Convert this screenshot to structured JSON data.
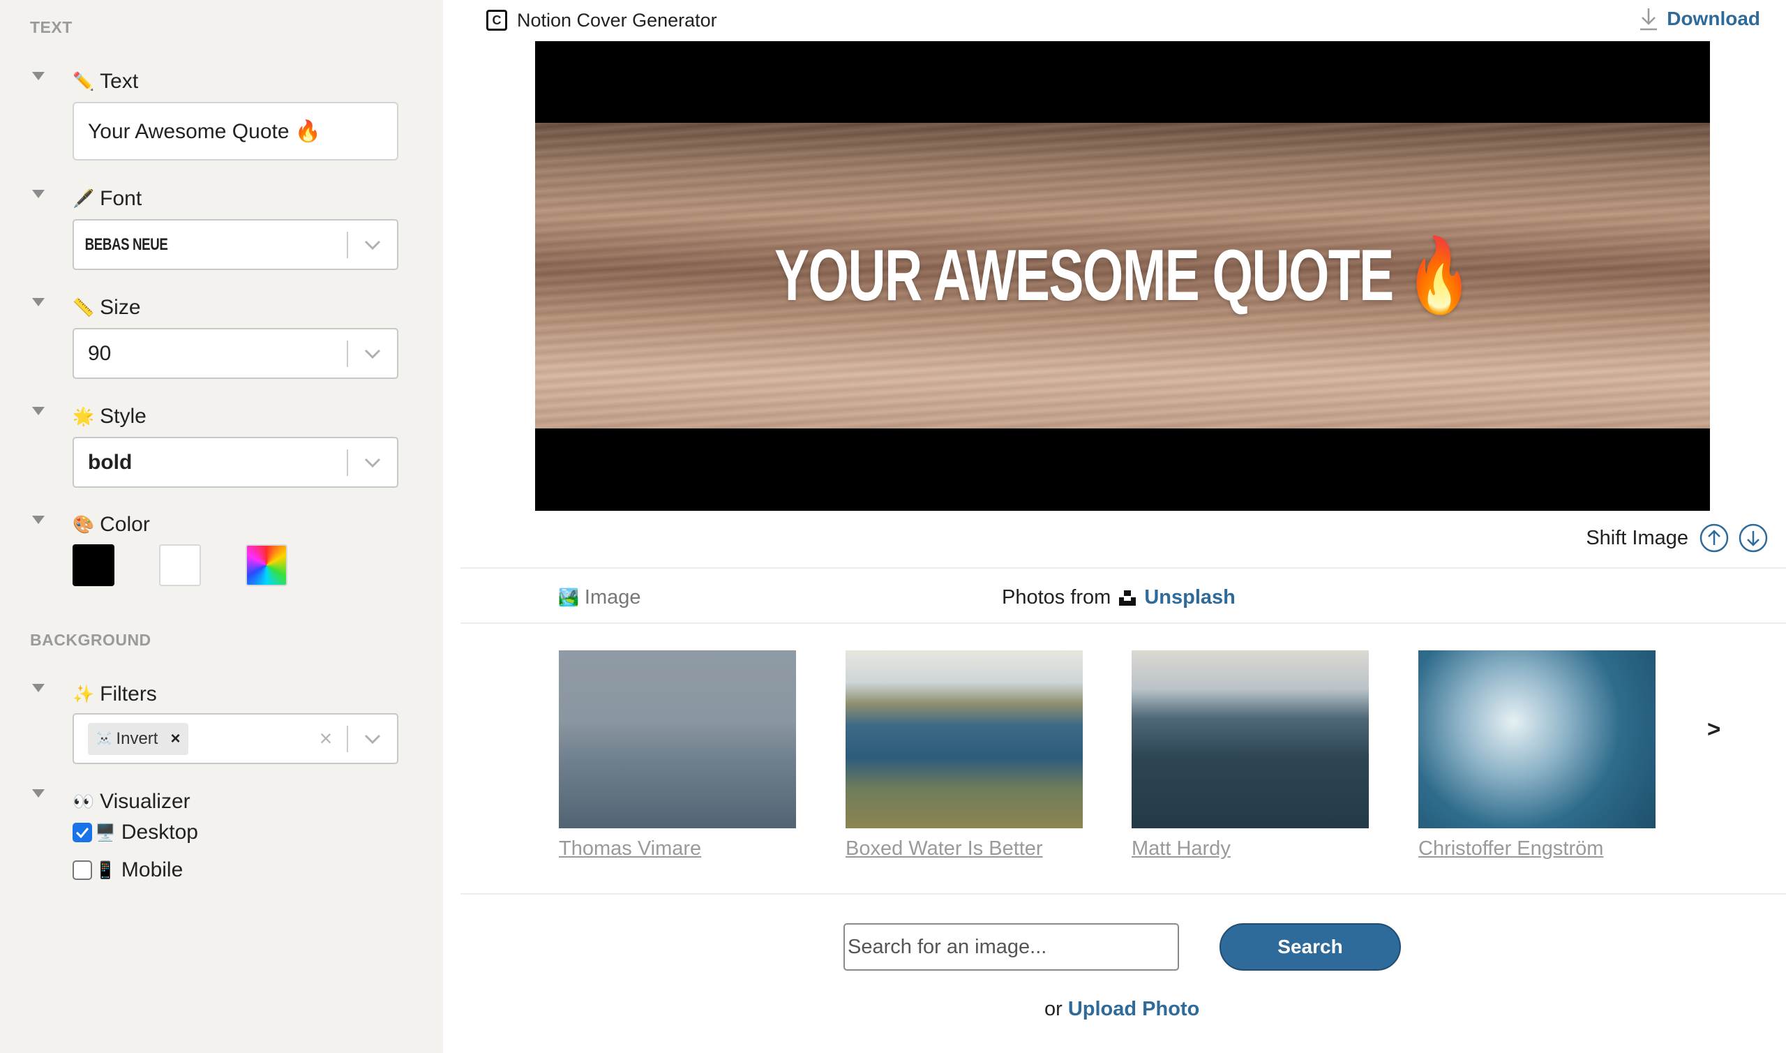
{
  "sidebar": {
    "text_section_title": "TEXT",
    "background_section_title": "BACKGROUND",
    "text_field": {
      "emoji": "✏️",
      "label": "Text",
      "value": "Your Awesome Quote 🔥"
    },
    "font_field": {
      "emoji": "🖋️",
      "label": "Font",
      "value": "BEBAS NEUE"
    },
    "size_field": {
      "emoji": "📏",
      "label": "Size",
      "value": "90"
    },
    "style_field": {
      "emoji": "🌟",
      "label": "Style",
      "value": "bold"
    },
    "color_field": {
      "emoji": "🎨",
      "label": "Color",
      "swatches": [
        "#000000",
        "#ffffff",
        "rainbow"
      ]
    },
    "filters_field": {
      "emoji": "✨",
      "label": "Filters",
      "tag_emoji": "☠️",
      "tag_label": "Invert",
      "tag_remove": "×",
      "clear": "×"
    },
    "visualizer_field": {
      "emoji": "👀",
      "label": "Visualizer",
      "desktop": {
        "emoji": "🖥️",
        "label": "Desktop",
        "checked": true
      },
      "mobile": {
        "emoji": "📱",
        "label": "Mobile",
        "checked": false
      }
    }
  },
  "header": {
    "app_title": "Notion Cover Generator",
    "download_label": "Download"
  },
  "preview": {
    "quote_text": "YOUR AWESOME QUOTE 🔥",
    "shift_label": "Shift Image"
  },
  "gallery": {
    "tab_emoji": "🏞️",
    "tab_label": "Image",
    "photos_from": "Photos from",
    "source_link": "Unsplash",
    "photos": [
      {
        "credit": "Thomas Vimare"
      },
      {
        "credit": "Boxed Water Is Better"
      },
      {
        "credit": "Matt Hardy"
      },
      {
        "credit": "Christoffer Engström"
      }
    ],
    "next_label": ">"
  },
  "search": {
    "placeholder": "Search for an image...",
    "button_label": "Search",
    "upload_prefix": "or",
    "upload_link": "Upload Photo"
  },
  "colors": {
    "accent": "#2e6a9a",
    "sidebar_bg": "#f3f2ef",
    "checkbox": "#1a73e8"
  }
}
